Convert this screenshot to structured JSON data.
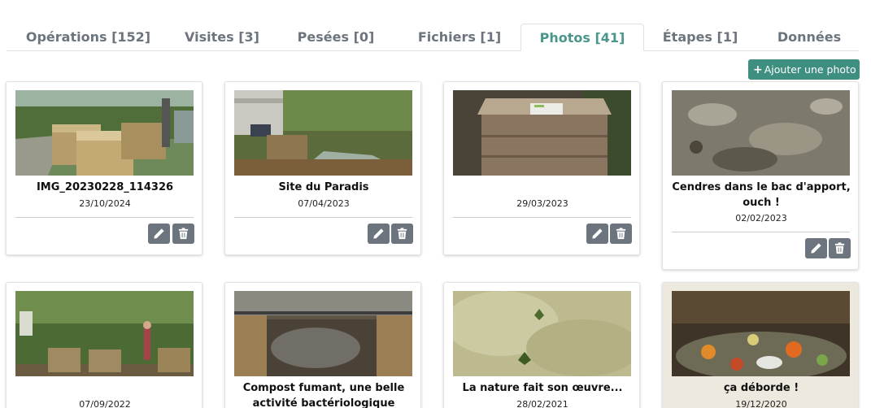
{
  "tabs": [
    {
      "label": "Opérations [152]",
      "active": false
    },
    {
      "label": "Visites [3]",
      "active": false
    },
    {
      "label": "Pesées [0]",
      "active": false
    },
    {
      "label": "Fichiers [1]",
      "active": false
    },
    {
      "label": "Photos [41]",
      "active": true
    },
    {
      "label": "Étapes [1]",
      "active": false
    },
    {
      "label": "Données",
      "active": false
    }
  ],
  "add_photo_label": "Ajouter une photo",
  "add_photo_icon": "plus-icon",
  "edit_icon": "pencil-icon",
  "delete_icon": "trash-icon",
  "colors": {
    "accent": "#4a968a",
    "button": "#3f8f80",
    "action_button": "#6c757d",
    "highlight_card": "#ede9df"
  },
  "photos": [
    {
      "caption": "IMG_20230228_114326",
      "date": "23/10/2024",
      "scene": "compost bins with trees"
    },
    {
      "caption": "Site du Paradis",
      "date": "07/04/2023",
      "scene": "garden with tarp"
    },
    {
      "caption": "",
      "date": "29/03/2023",
      "scene": "wooden compost bin with sign"
    },
    {
      "caption": "Cendres dans le bac d'apport, ouch !",
      "date": "02/02/2023",
      "scene": "ashes in compost"
    },
    {
      "caption": "",
      "date": "07/09/2022",
      "scene": "people at compost bins"
    },
    {
      "caption": "Compost fumant, une belle activité bactériologique",
      "date": "",
      "scene": "steaming compost"
    },
    {
      "caption": "La nature fait son œuvre...",
      "date": "28/02/2021",
      "scene": "moldy compost surface"
    },
    {
      "caption": "ça déborde !",
      "date": "19/12/2020",
      "scene": "overflowing food waste"
    }
  ]
}
